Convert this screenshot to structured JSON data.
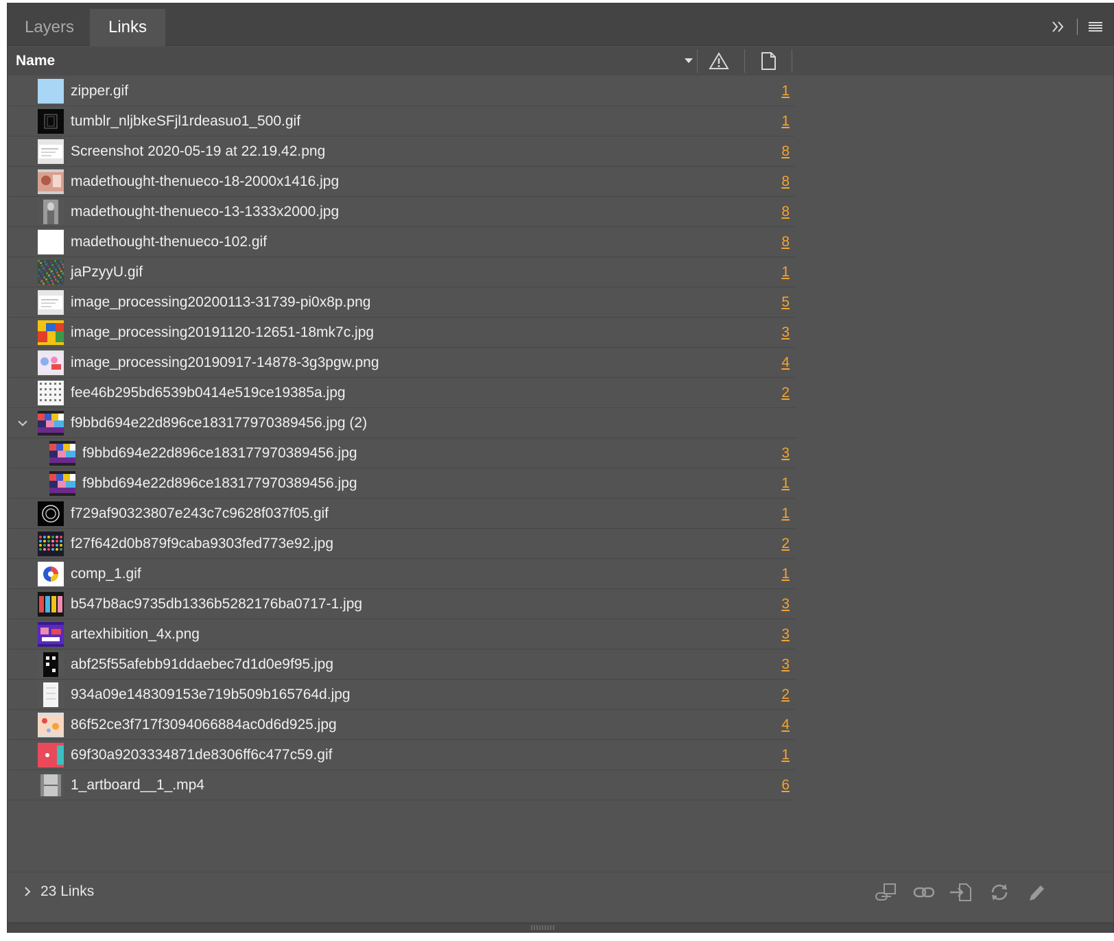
{
  "tabs": [
    {
      "label": "Layers",
      "active": false
    },
    {
      "label": "Links",
      "active": true
    }
  ],
  "header": {
    "name_label": "Name",
    "columns": [
      "warning-icon",
      "page-icon"
    ]
  },
  "links": [
    {
      "name": "zipper.gif",
      "page": "1",
      "thumb": "lightblue"
    },
    {
      "name": "tumblr_nljbkeSFjl1rdeasuo1_500.gif",
      "page": "1",
      "thumb": "black-pattern"
    },
    {
      "name": "Screenshot 2020-05-19 at 22.19.42.png",
      "page": "8",
      "thumb": "white-doc"
    },
    {
      "name": "madethought-thenueco-18-2000x1416.jpg",
      "page": "8",
      "thumb": "pink-photo"
    },
    {
      "name": "madethought-thenueco-13-1333x2000.jpg",
      "page": "8",
      "thumb": "gray-figure"
    },
    {
      "name": "madethought-thenueco-102.gif",
      "page": "8",
      "thumb": "white"
    },
    {
      "name": "jaPzyyU.gif",
      "page": "1",
      "thumb": "noise"
    },
    {
      "name": "image_processing20200113-31739-pi0x8p.png",
      "page": "5",
      "thumb": "white-doc"
    },
    {
      "name": "image_processing20191120-12651-18mk7c.jpg",
      "page": "3",
      "thumb": "yellow-blocks"
    },
    {
      "name": "image_processing20190917-14878-3g3pgw.png",
      "page": "4",
      "thumb": "pastel"
    },
    {
      "name": "fee46b295bd6539b0414e519ce19385a.jpg",
      "page": "2",
      "thumb": "white-grid"
    },
    {
      "name": "f9bbd694e22d896ce183177970389456.jpg (2)",
      "page": "",
      "thumb": "colorful",
      "group": true
    },
    {
      "name": "f9bbd694e22d896ce183177970389456.jpg",
      "page": "3",
      "thumb": "colorful",
      "child": true
    },
    {
      "name": "f9bbd694e22d896ce183177970389456.jpg",
      "page": "1",
      "thumb": "colorful",
      "child": true
    },
    {
      "name": "f729af90323807e243c7c9628f037f05.gif",
      "page": "1",
      "thumb": "black-circle"
    },
    {
      "name": "f27f642d0b879f9caba9303fed773e92.jpg",
      "page": "2",
      "thumb": "dots"
    },
    {
      "name": "comp_1.gif",
      "page": "1",
      "thumb": "logo"
    },
    {
      "name": "b547b8ac9735db1336b5282176ba0717-1.jpg",
      "page": "3",
      "thumb": "dark-colorful"
    },
    {
      "name": "artexhibition_4x.png",
      "page": "3",
      "thumb": "purple"
    },
    {
      "name": "abf25f55afebb91ddaebec7d1d0e9f95.jpg",
      "page": "3",
      "thumb": "black-tall"
    },
    {
      "name": "934a09e148309153e719b509b165764d.jpg",
      "page": "2",
      "thumb": "white-tall"
    },
    {
      "name": "86f52ce3f717f3094066884ac0d6d925.jpg",
      "page": "4",
      "thumb": "peach"
    },
    {
      "name": "69f30a9203334871de8306ff6c477c59.gif",
      "page": "1",
      "thumb": "red-teal"
    },
    {
      "name": "1_artboard__1_.mp4",
      "page": "6",
      "thumb": "video"
    }
  ],
  "footer": {
    "count_label": "23 Links",
    "actions": [
      "relink-from-cc-icon",
      "relink-icon",
      "go-to-link-icon",
      "update-link-icon",
      "edit-original-icon"
    ]
  },
  "colors": {
    "panel_bg": "#535353",
    "tab_bg": "#444444",
    "page_link": "#f2a534"
  }
}
